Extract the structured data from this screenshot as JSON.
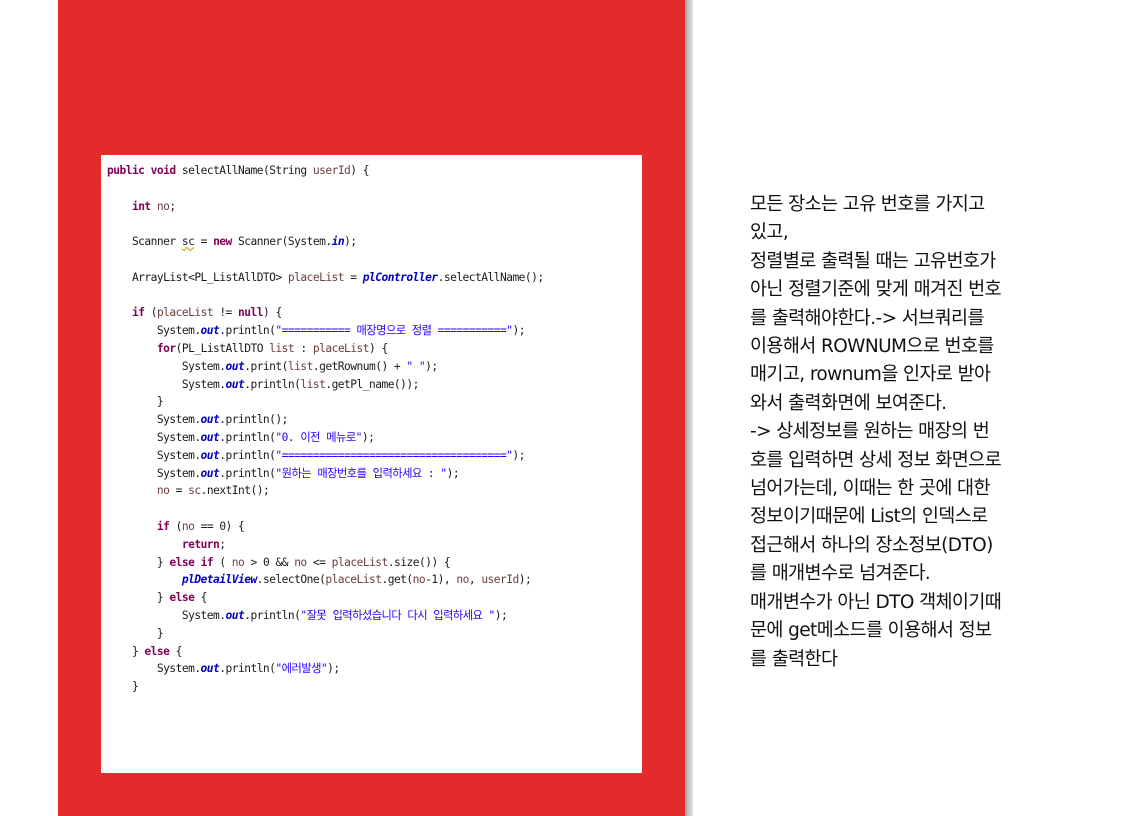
{
  "colors": {
    "panel_red": "#e32b2c",
    "keyword": "#7f0055",
    "string": "#2a00ff",
    "field": "#0000c0",
    "variable": "#6a3e3e"
  },
  "code": {
    "lines": [
      [
        [
          "kw",
          "public"
        ],
        [
          "",
          " "
        ],
        [
          "kw",
          "void"
        ],
        [
          "",
          " selectAllName(String "
        ],
        [
          "var",
          "userId"
        ],
        [
          "",
          ") {"
        ]
      ],
      [],
      [
        [
          "",
          "    "
        ],
        [
          "kw",
          "int"
        ],
        [
          "",
          " "
        ],
        [
          "var",
          "no"
        ],
        [
          "",
          ";"
        ]
      ],
      [],
      [
        [
          "",
          "    Scanner "
        ],
        [
          "warn",
          "sc"
        ],
        [
          "",
          " = "
        ],
        [
          "kw",
          "new"
        ],
        [
          "",
          " Scanner(System."
        ],
        [
          "fld",
          "in"
        ],
        [
          "",
          ");"
        ]
      ],
      [],
      [
        [
          "",
          "    ArrayList<PL_ListAllDTO> "
        ],
        [
          "var",
          "placeList"
        ],
        [
          "",
          " = "
        ],
        [
          "fld",
          "plController"
        ],
        [
          "",
          ".selectAllName();"
        ]
      ],
      [],
      [
        [
          "",
          "    "
        ],
        [
          "kw",
          "if"
        ],
        [
          "",
          " ("
        ],
        [
          "var",
          "placeList"
        ],
        [
          "",
          " != "
        ],
        [
          "kw",
          "null"
        ],
        [
          "",
          ") {"
        ]
      ],
      [
        [
          "",
          "        System."
        ],
        [
          "fld",
          "out"
        ],
        [
          "",
          ".println("
        ],
        [
          "str",
          "\"=========== 매장명으로 정렬 ===========\""
        ],
        [
          "",
          ");"
        ]
      ],
      [
        [
          "",
          "        "
        ],
        [
          "kw",
          "for"
        ],
        [
          "",
          "(PL_ListAllDTO "
        ],
        [
          "var",
          "list"
        ],
        [
          "",
          " : "
        ],
        [
          "var",
          "placeList"
        ],
        [
          "",
          ") {"
        ]
      ],
      [
        [
          "",
          "            System."
        ],
        [
          "fld",
          "out"
        ],
        [
          "",
          ".print("
        ],
        [
          "var",
          "list"
        ],
        [
          "",
          ".getRownum() + "
        ],
        [
          "str",
          "\" \""
        ],
        [
          "",
          ");"
        ]
      ],
      [
        [
          "",
          "            System."
        ],
        [
          "fld",
          "out"
        ],
        [
          "",
          ".println("
        ],
        [
          "var",
          "list"
        ],
        [
          "",
          ".getPl_name());"
        ]
      ],
      [
        [
          "",
          "        }"
        ]
      ],
      [
        [
          "",
          "        System."
        ],
        [
          "fld",
          "out"
        ],
        [
          "",
          ".println();"
        ]
      ],
      [
        [
          "",
          "        System."
        ],
        [
          "fld",
          "out"
        ],
        [
          "",
          ".println("
        ],
        [
          "str",
          "\"0. 이전 메뉴로\""
        ],
        [
          "",
          ");"
        ]
      ],
      [
        [
          "",
          "        System."
        ],
        [
          "fld",
          "out"
        ],
        [
          "",
          ".println("
        ],
        [
          "str",
          "\"====================================\""
        ],
        [
          "",
          ");"
        ]
      ],
      [
        [
          "",
          "        System."
        ],
        [
          "fld",
          "out"
        ],
        [
          "",
          ".println("
        ],
        [
          "str",
          "\"원하는 매장번호를 입력하세요 : \""
        ],
        [
          "",
          ");"
        ]
      ],
      [
        [
          "",
          "        "
        ],
        [
          "var",
          "no"
        ],
        [
          "",
          " = "
        ],
        [
          "var",
          "sc"
        ],
        [
          "",
          ".nextInt();"
        ]
      ],
      [],
      [
        [
          "",
          "        "
        ],
        [
          "kw",
          "if"
        ],
        [
          "",
          " ("
        ],
        [
          "var",
          "no"
        ],
        [
          "",
          " == 0) {"
        ]
      ],
      [
        [
          "",
          "            "
        ],
        [
          "kw",
          "return"
        ],
        [
          "",
          ";"
        ]
      ],
      [
        [
          "",
          "        } "
        ],
        [
          "kw",
          "else"
        ],
        [
          "",
          " "
        ],
        [
          "kw",
          "if"
        ],
        [
          "",
          " ( "
        ],
        [
          "var",
          "no"
        ],
        [
          "",
          " > 0 && "
        ],
        [
          "var",
          "no"
        ],
        [
          "",
          " <= "
        ],
        [
          "var",
          "placeList"
        ],
        [
          "",
          ".size()) {"
        ]
      ],
      [
        [
          "",
          "            "
        ],
        [
          "fld",
          "plDetailView"
        ],
        [
          "",
          ".selectOne("
        ],
        [
          "var",
          "placeList"
        ],
        [
          "",
          ".get("
        ],
        [
          "var",
          "no"
        ],
        [
          "",
          "-1), "
        ],
        [
          "var",
          "no"
        ],
        [
          "",
          ", "
        ],
        [
          "var",
          "userId"
        ],
        [
          "",
          ");"
        ]
      ],
      [
        [
          "",
          "        } "
        ],
        [
          "kw",
          "else"
        ],
        [
          "",
          " {"
        ]
      ],
      [
        [
          "",
          "            System."
        ],
        [
          "fld",
          "out"
        ],
        [
          "",
          ".println("
        ],
        [
          "str",
          "\"잘못 입력하셨습니다 다시 입력하세요 \""
        ],
        [
          "",
          ");"
        ]
      ],
      [
        [
          "",
          "        }"
        ]
      ],
      [
        [
          "",
          "    } "
        ],
        [
          "kw",
          "else"
        ],
        [
          "",
          " {"
        ]
      ],
      [
        [
          "",
          "        System."
        ],
        [
          "fld",
          "out"
        ],
        [
          "",
          ".println("
        ],
        [
          "str",
          "\"에러발생\""
        ],
        [
          "",
          ");"
        ]
      ],
      [
        [
          "",
          "    }"
        ]
      ]
    ]
  },
  "notes": {
    "lines": [
      "모든 장소는 고유 번호를 가지고",
      "있고,",
      "정렬별로 출력될 때는 고유번호가",
      "아닌 정렬기준에 맞게 매겨진 번호",
      "를 출력해야한다.-> 서브쿼리를",
      "이용해서 ROWNUM으로 번호를",
      "매기고, rownum을 인자로 받아",
      "와서 출력화면에 보여준다.",
      "-> 상세정보를 원하는 매장의 번",
      "호를 입력하면 상세 정보 화면으로",
      "넘어가는데, 이때는 한 곳에 대한",
      "정보이기때문에 List의 인덱스로",
      "접근해서 하나의 장소정보(DTO)",
      "를 매개변수로 넘겨준다.",
      "매개변수가 아닌 DTO 객체이기때",
      "문에 get메소드를 이용해서 정보",
      "를 출력한다"
    ]
  }
}
